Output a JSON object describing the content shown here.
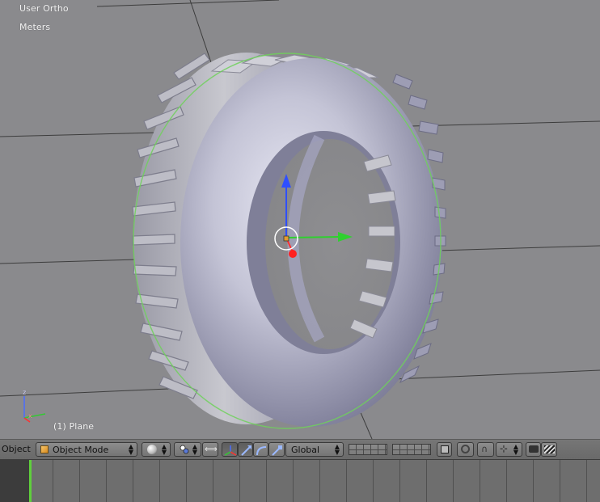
{
  "viewport": {
    "view_name": "User Ortho",
    "units": "Meters",
    "selected_object": "(1) Plane",
    "axis_x": "x",
    "axis_z": "z"
  },
  "header": {
    "editor_label": "Object",
    "mode_selector": {
      "value": "Object Mode",
      "icon": "object-cube-icon"
    },
    "shading_icon": "sphere-solid-icon",
    "pivot_icon": "pivot-icon",
    "snap_link_icon": "link-icon",
    "transform_manipulator_icons": [
      "axes-icon",
      "translate-arrow-icon",
      "rotate-icon",
      "scale-icon"
    ],
    "orientation": "Global",
    "render_icons": [
      "camera-icon",
      "clapper-icon"
    ]
  },
  "colors": {
    "viewport_bg": "#8a8a8d",
    "selection_outline": "#6fd15a",
    "axis_x": "#ff3030",
    "axis_y": "#2fd02f",
    "axis_z": "#2f4fff",
    "playhead": "#5fcf3c"
  }
}
